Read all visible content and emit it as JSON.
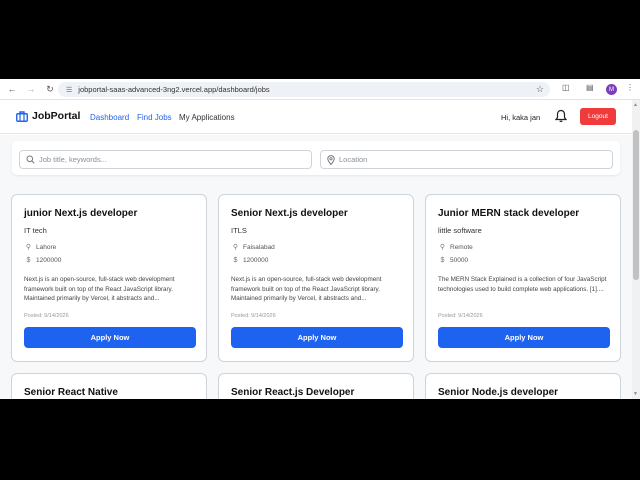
{
  "browser": {
    "url": "jobportal-saas-advanced-3ng2.vercel.app/dashboard/jobs",
    "avatar_letter": "M"
  },
  "header": {
    "brand": "JobPortal",
    "nav": [
      {
        "label": "Dashboard",
        "color": "#2563eb"
      },
      {
        "label": "Find Jobs",
        "color": "#2563eb"
      },
      {
        "label": "My Applications",
        "color": "#333333"
      }
    ],
    "greeting": "Hi, kaka jan",
    "logout_label": "Logout"
  },
  "search": {
    "keywords_placeholder": "Job title, keywords...",
    "location_placeholder": "Location"
  },
  "jobs": [
    {
      "title": "junior Next.js developer",
      "company": "IT tech",
      "location": "Lahore",
      "salary": "1200000",
      "description": "Next.js is an open-source, full-stack web development framework built on top of the React JavaScript library. Maintained primarily by Vercel, it abstracts and...",
      "posted": "Posted: 9/14/2026",
      "apply_label": "Apply Now"
    },
    {
      "title": "Senior Next.js developer",
      "company": "ITLS",
      "location": "Faisalabad",
      "salary": "1200000",
      "description": "Next.js is an open-source, full-stack web development framework built on top of the React JavaScript library. Maintained primarily by Vercel, it abstracts and...",
      "posted": "Posted: 9/14/2026",
      "apply_label": "Apply Now"
    },
    {
      "title": "Junior MERN stack developer",
      "company": "little software",
      "location": "Remote",
      "salary": "50000",
      "description": "The MERN Stack Explained is a collection of four JavaScript technologies used to build complete web applications. [1]....",
      "posted": "Posted: 9/14/2026",
      "apply_label": "Apply Now"
    },
    {
      "title": "Senior React Native"
    },
    {
      "title": "Senior React.js Developer"
    },
    {
      "title": "Senior Node.js developer"
    }
  ]
}
